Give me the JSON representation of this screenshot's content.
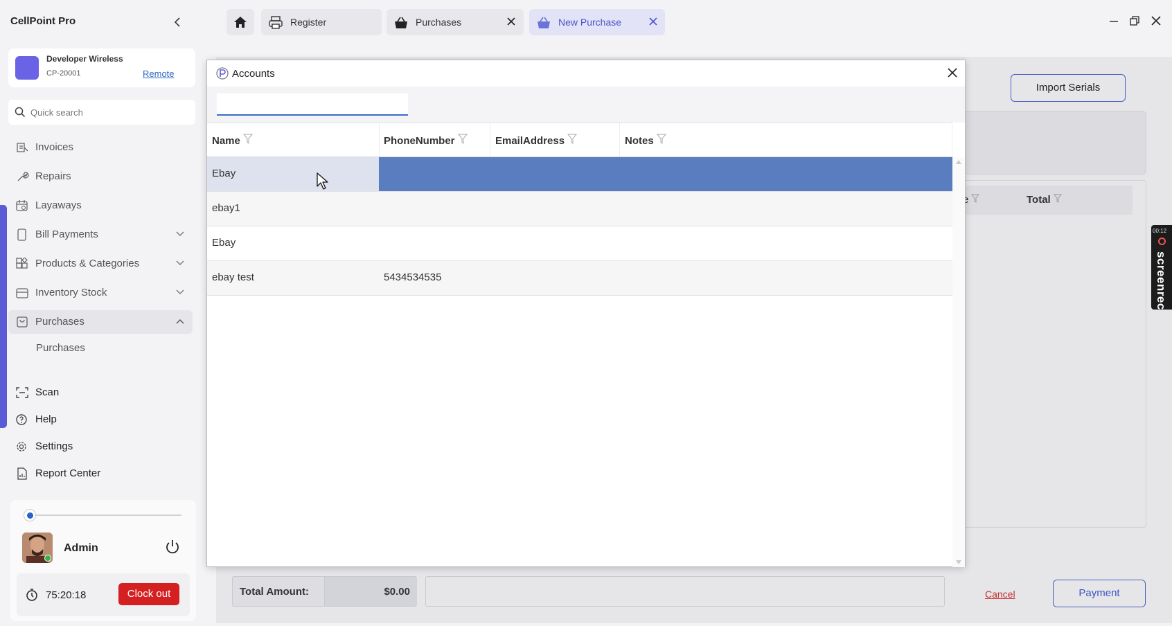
{
  "app": {
    "title": "CellPoint Pro"
  },
  "store": {
    "name": "Developer Wireless",
    "id": "CP-20001",
    "remote_link": "Remote"
  },
  "sidebar": {
    "search_placeholder": "Quick search",
    "items": [
      {
        "label": "Invoices",
        "icon": "invoice-icon"
      },
      {
        "label": "Repairs",
        "icon": "wrench-icon"
      },
      {
        "label": "Layaways",
        "icon": "calendar-icon"
      },
      {
        "label": "Bill Payments",
        "icon": "bill-icon",
        "expandable": true
      },
      {
        "label": "Products & Categories",
        "icon": "grid-icon",
        "expandable": true
      },
      {
        "label": "Inventory Stock",
        "icon": "box-icon",
        "expandable": true
      },
      {
        "label": "Purchases",
        "icon": "bag-icon",
        "expanded": true
      },
      {
        "label": "Scan",
        "icon": "scan-icon"
      },
      {
        "label": "Help",
        "icon": "help-icon"
      },
      {
        "label": "Settings",
        "icon": "gear-icon"
      },
      {
        "label": "Report Center",
        "icon": "report-icon"
      }
    ],
    "purchases_sub": [
      "Purchases"
    ]
  },
  "user": {
    "name": "Admin",
    "session_time": "75:20:18",
    "clock_out_label": "Clock out"
  },
  "tabs": [
    {
      "label": "Register",
      "icon": "printer-icon",
      "closable": false
    },
    {
      "label": "Purchases",
      "icon": "basket-icon",
      "closable": true
    },
    {
      "label": "New Purchase",
      "icon": "basket-icon",
      "closable": true,
      "active": true
    }
  ],
  "purchase": {
    "import_serials_label": "Import Serials",
    "grid_partial_header": "e",
    "grid_total_header": "Total",
    "total_amount_label": "Total Amount:",
    "total_amount_value": "$0.00",
    "cancel_label": "Cancel",
    "payment_label": "Payment"
  },
  "dialog": {
    "title": "Accounts",
    "search_value": "",
    "columns": [
      "Name",
      "PhoneNumber",
      "EmailAddress",
      "Notes"
    ],
    "rows": [
      {
        "name": "Ebay",
        "phone": "",
        "email": "",
        "notes": "",
        "selected": true
      },
      {
        "name": "ebay1",
        "phone": "",
        "email": "",
        "notes": ""
      },
      {
        "name": "Ebay",
        "phone": "",
        "email": "",
        "notes": ""
      },
      {
        "name": "ebay test",
        "phone": "5434534535",
        "email": "",
        "notes": ""
      }
    ]
  },
  "overlay": {
    "recorder_label": "screenrec",
    "recorder_time": "00:12"
  },
  "colors": {
    "accent": "#5b5bd6",
    "selection": "#5a7dbf",
    "danger": "#d42020",
    "link": "#2d68c4"
  }
}
